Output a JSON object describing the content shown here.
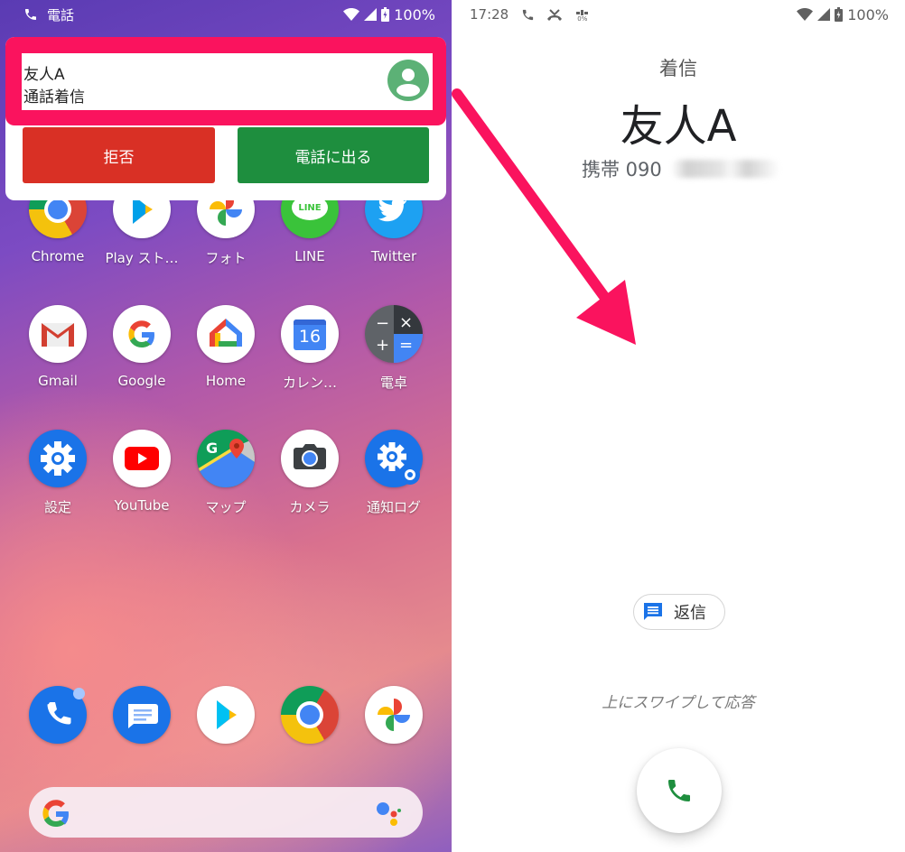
{
  "left_screen": {
    "status_bar": {
      "notification_label": "電話",
      "battery": "100%"
    },
    "notification": {
      "caller": "友人A",
      "subtitle": "通話着信",
      "reject_label": "拒否",
      "answer_label": "電話に出る",
      "highlight_color": "#fa135e"
    },
    "apps": [
      {
        "label": "Chrome",
        "icon": "chrome-icon"
      },
      {
        "label": "Play スト…",
        "icon": "play-store-icon"
      },
      {
        "label": "フォト",
        "icon": "photos-icon"
      },
      {
        "label": "LINE",
        "icon": "line-icon"
      },
      {
        "label": "Twitter",
        "icon": "twitter-icon"
      },
      {
        "label": "Gmail",
        "icon": "gmail-icon"
      },
      {
        "label": "Google",
        "icon": "google-icon"
      },
      {
        "label": "Home",
        "icon": "google-home-icon"
      },
      {
        "label": "カレン…",
        "icon": "calendar-icon",
        "badge_text": "16"
      },
      {
        "label": "電卓",
        "icon": "calculator-icon"
      },
      {
        "label": "設定",
        "icon": "settings-icon"
      },
      {
        "label": "YouTube",
        "icon": "youtube-icon"
      },
      {
        "label": "マップ",
        "icon": "maps-icon"
      },
      {
        "label": "カメラ",
        "icon": "camera-icon"
      },
      {
        "label": "通知ログ",
        "icon": "notification-log-icon"
      }
    ],
    "dock": [
      {
        "icon": "phone-icon"
      },
      {
        "icon": "messages-icon"
      },
      {
        "icon": "play-store-icon"
      },
      {
        "icon": "chrome-icon"
      },
      {
        "icon": "photos-icon"
      }
    ]
  },
  "right_screen": {
    "status_bar": {
      "time": "17:28",
      "data_saver_text": "0%",
      "battery": "100%"
    },
    "incoming_label": "着信",
    "caller_name": "友人A",
    "caller_number_prefix": "携帯 090",
    "reply_label": "返信",
    "swipe_hint": "上にスワイプして応答"
  }
}
